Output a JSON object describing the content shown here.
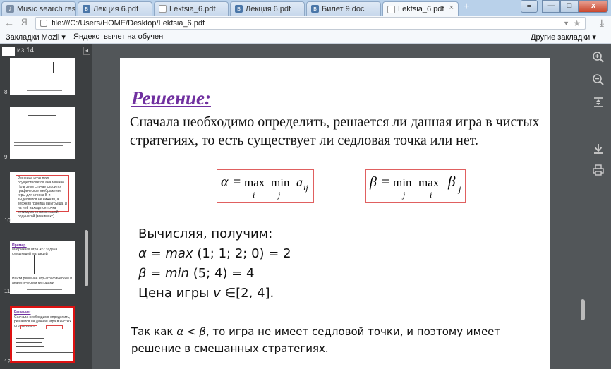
{
  "tabs": [
    {
      "label": "Music search resu",
      "icon": "music-icon",
      "active": false
    },
    {
      "label": "Лекция 6.pdf",
      "icon": "vk-icon",
      "active": false
    },
    {
      "label": "Lektsia_6.pdf",
      "icon": "pdf-icon",
      "active": false
    },
    {
      "label": "Лекция 6.pdf",
      "icon": "vk-icon",
      "active": false
    },
    {
      "label": "Билет 9.doc",
      "icon": "vk-icon",
      "active": false
    },
    {
      "label": "Lektsia_6.pdf",
      "icon": "pdf-icon",
      "active": true
    }
  ],
  "tab_close": "×",
  "new_tab": "+",
  "window": {
    "minimize": "—",
    "maximize": "□",
    "close": "x"
  },
  "nav": {
    "back": "←",
    "yandex": "Я",
    "reload": "C",
    "url": "file:///C:/Users/HOME/Desktop/Lektsia_6.pdf",
    "download": "⤓"
  },
  "bookmarks": {
    "folder": "Закладки Mozil",
    "items": [
      "Яндекс",
      "вычет на обучен"
    ],
    "other": "Другие закладки"
  },
  "pdf": {
    "page_of": "из 14",
    "thumb_numbers": [
      "8",
      "9",
      "10",
      "11",
      "12"
    ],
    "thumb_texts": {
      "t10": "Решение игры mxn осуществляется аналогично. Но в этом случае строится графическое изображение игры для игрока В и выделяется не нижняя, а верхняя граница выигрыша, и на ней находится точка оптимума с наименьшей ординатой (минимакс).",
      "t11_head": "Пример.",
      "t11_body": "Матричная игра 4x2 задана следующей матрицей",
      "t11_found": "Найти решение игры графическим и аналитическим методами",
      "t12_head": "Решение:",
      "t12_body": "Сначала необходимо определить, решается ли данная игра в чистых стратегиях..."
    },
    "heading": "Решение:",
    "intro": "Сначала необходимо определить, решается ли данная игра в чистых стратегиях, то есть существует ли седловая точка или нет.",
    "formula_alpha": {
      "symbol": "α",
      "eq": "=",
      "op1": "max",
      "op2": "min",
      "sub1": "i",
      "sub2": "j",
      "var": "a",
      "var_sub": "ij"
    },
    "formula_beta": {
      "symbol": "β",
      "eq": "=",
      "op1": "min",
      "op2": "max",
      "sub1": "j",
      "sub2": "i",
      "var": "β",
      "var_sub": "j"
    },
    "calc": {
      "line1": "Вычисляя, получим:",
      "line2_pre": "α = ",
      "line2_fn": "max",
      "line2_post": " (1; 1; 2; 0) = 2",
      "line3_pre": "β = ",
      "line3_fn": "min",
      "line3_post": " (5; 4) = 4",
      "line4_pre": "Цена игры ",
      "line4_var": "v",
      "line4_post": " ∈[2, 4]."
    },
    "conclusion_pre": "Так как ",
    "conclusion_math": "α < β",
    "conclusion_post": ", то игра не имеет седловой точки, и поэтому имеет решение в смешанных стратегиях."
  }
}
